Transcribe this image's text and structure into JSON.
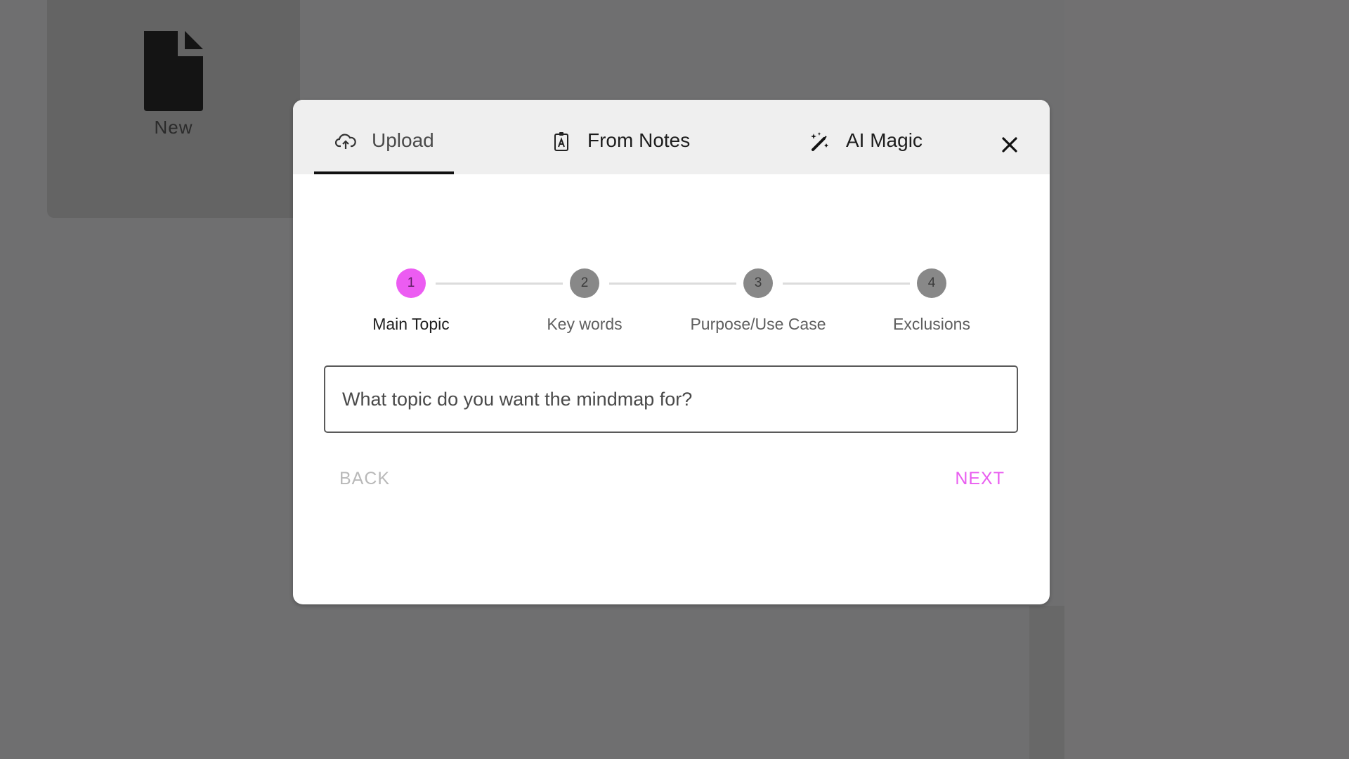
{
  "background": {
    "tile": {
      "label": "New",
      "icon": "file-icon"
    }
  },
  "dialog": {
    "tabs": [
      {
        "label": "Upload",
        "icon": "cloud-upload-icon",
        "active": true
      },
      {
        "label": "From Notes",
        "icon": "clipboard-account-icon",
        "active": false
      },
      {
        "label": "AI Magic",
        "icon": "magic-wand-icon",
        "active": false
      }
    ],
    "close_icon": "close-icon",
    "stepper": {
      "current_step": 1,
      "steps": [
        {
          "number": "1",
          "label": "Main Topic"
        },
        {
          "number": "2",
          "label": "Key words"
        },
        {
          "number": "3",
          "label": "Purpose/Use Case"
        },
        {
          "number": "4",
          "label": "Exclusions"
        }
      ]
    },
    "topic_input": {
      "value": "",
      "placeholder": "What topic do you want the mindmap for?"
    },
    "back_label": "BACK",
    "next_label": "NEXT",
    "colors": {
      "accent": "#ec5cf2",
      "inactive_step": "#888888",
      "disabled_text": "#b9b9b9"
    }
  }
}
